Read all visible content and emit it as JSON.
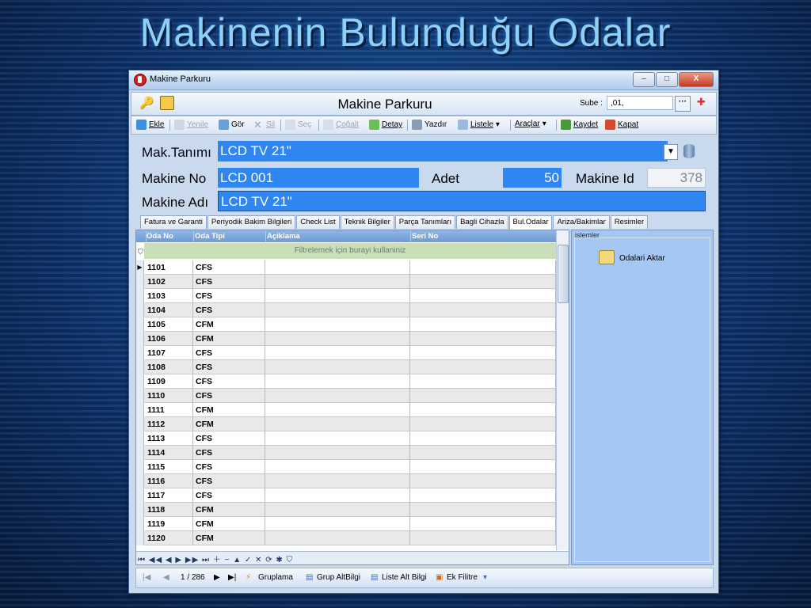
{
  "slide_title": "Makinenin Bulunduğu Odalar",
  "window": {
    "title": "Makine Parkuru",
    "form_title": "Makine Parkuru",
    "sube_label": "Sube :",
    "sube_value": ",01,",
    "sube_btn": "···",
    "controls": {
      "min": "–",
      "max": "□",
      "close": "X"
    }
  },
  "toolbar": {
    "ekle": "Ekle",
    "yenile": "Yenile",
    "gor": "Gör",
    "sil": "Sil",
    "sec": "Seç",
    "cogalt": "Çoğalt",
    "detay": "Detay",
    "yazdir": "Yazdır",
    "listele": "Listele",
    "araclar": "Araçlar",
    "kaydet": "Kaydet",
    "kapat": "Kapat"
  },
  "form": {
    "mak_tanimi_label": "Mak.Tanımı",
    "mak_tanimi_value": "LCD TV 21\"",
    "makine_no_label": "Makine No",
    "makine_no_value": "LCD 001",
    "adet_label": "Adet",
    "adet_value": "50",
    "makine_id_label": "Makine Id",
    "makine_id_value": "378",
    "makine_adi_label": "Makine Adı",
    "makine_adi_value": "LCD TV 21\""
  },
  "tabs": [
    "Fatura ve Garanti",
    "Periyodik Bakim Bilgileri",
    "Check List",
    "Teknik Bilgiler",
    "Parça Tanımları",
    "Bagli Cihazla",
    "Bul.Odalar",
    "Ariza/Bakimlar",
    "Resimler"
  ],
  "active_tab": "Bul.Odalar",
  "grid": {
    "columns": [
      "Oda No",
      "Oda Tipi",
      "Açiklama",
      "Seri No"
    ],
    "filter_text": "Filtrelemek için burayi kullaniniz",
    "rows": [
      [
        "1101",
        "CFS"
      ],
      [
        "1102",
        "CFS"
      ],
      [
        "1103",
        "CFS"
      ],
      [
        "1104",
        "CFS"
      ],
      [
        "1105",
        "CFM"
      ],
      [
        "1106",
        "CFM"
      ],
      [
        "1107",
        "CFS"
      ],
      [
        "1108",
        "CFS"
      ],
      [
        "1109",
        "CFS"
      ],
      [
        "1110",
        "CFS"
      ],
      [
        "1111",
        "CFM"
      ],
      [
        "1112",
        "CFM"
      ],
      [
        "1113",
        "CFS"
      ],
      [
        "1114",
        "CFS"
      ],
      [
        "1115",
        "CFS"
      ],
      [
        "1116",
        "CFS"
      ],
      [
        "1117",
        "CFS"
      ],
      [
        "1118",
        "CFM"
      ],
      [
        "1119",
        "CFM"
      ],
      [
        "1120",
        "CFM"
      ]
    ]
  },
  "islemler": {
    "title": "islemler",
    "aktar_label": "Odalari Aktar"
  },
  "status": {
    "page": "1 / 286",
    "gruplama": "Gruplama",
    "grup_altbilgi": "Grup AltBilgi",
    "liste_alt_bilgi": "Liste Alt Bilgi",
    "ek_filtre": "Ek Filitre"
  }
}
